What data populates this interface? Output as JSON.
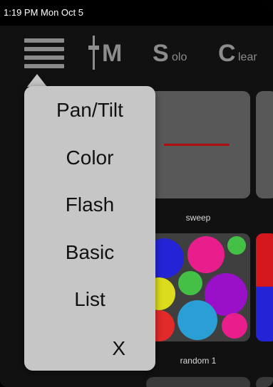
{
  "status_bar": {
    "time_date": "1:19 PM  Mon Oct 5"
  },
  "toolbar": {
    "m_label": "M",
    "solo_big": "S",
    "solo_small": "olo",
    "clear_big": "C",
    "clear_small": "lear"
  },
  "menu": {
    "items": [
      {
        "label": "Pan/Tilt"
      },
      {
        "label": "Color"
      },
      {
        "label": "Flash"
      },
      {
        "label": "Basic"
      },
      {
        "label": "List"
      },
      {
        "label": "X"
      }
    ]
  },
  "tiles": [
    {
      "label": "sweep"
    },
    {
      "label": "random 1"
    }
  ],
  "colors": {
    "sweep_line": "#b10e10",
    "menu_bg": "#c6c6c6",
    "random_circles": [
      "#2424d6",
      "#e91e8d",
      "#44c046",
      "#9a10c8",
      "#dcdc1e",
      "#2a9fd5",
      "#e22a2a",
      "#1db3b8"
    ]
  }
}
